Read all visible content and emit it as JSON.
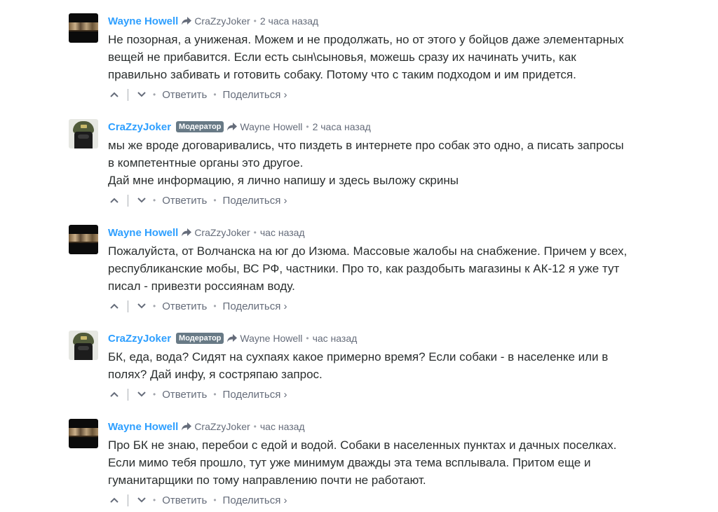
{
  "labels": {
    "reply": "Ответить",
    "share": "Поделиться ›",
    "moderator": "Модератор",
    "dot": "•"
  },
  "comments": [
    {
      "author": "Wayne Howell",
      "reply_to": "CraZzyJoker",
      "time": "2 часа назад",
      "avatar": "dark-banner-avatar",
      "lines": [
        "Не позорная, а униженая. Можем и не продолжать, но от этого у бойцов даже элементарных",
        "вещей не прибавится. Если есть сын\\сыновья, можешь сразу их начинать учить, как",
        "правильно забивать и готовить собаку. Потому что с таким подходом и им придется."
      ]
    },
    {
      "author": "CraZzyJoker",
      "reply_to": "Wayne Howell",
      "time": "2 часа назад",
      "avatar": "helmet-avatar",
      "moderator": true,
      "lines": [
        "мы же вроде договаривались, что пиздеть в интернете про собак это одно, а писать запросы",
        "в компетентные органы это другое.",
        "Дай мне информацию, я лично напишу и здесь выложу скрины"
      ]
    },
    {
      "author": "Wayne Howell",
      "reply_to": "CraZzyJoker",
      "time": "час назад",
      "avatar": "dark-banner-avatar",
      "lines": [
        "Пожалуйста, от Волчанска на юг до Изюма. Массовые жалобы на снабжение. Причем у всех,",
        "республиканские мобы, ВС РФ, частники. Про то, как раздобыть магазины к АК-12 я уже тут",
        "писал - привезти россиянам воду."
      ]
    },
    {
      "author": "CraZzyJoker",
      "reply_to": "Wayne Howell",
      "time": "час назад",
      "avatar": "helmet-avatar",
      "moderator": true,
      "lines": [
        "БК, еда, вода? Сидят на сухпаях какое примерно время? Если собаки - в населенке или в",
        "полях? Дай инфу, я состряпаю запрос."
      ]
    },
    {
      "author": "Wayne Howell",
      "reply_to": "CraZzyJoker",
      "time": "час назад",
      "avatar": "dark-banner-avatar",
      "lines": [
        "Про БК не знаю, перебои с едой и водой. Собаки в населенных пунктах и дачных поселках.",
        "Если мимо тебя прошло, тут уже минимум дважды эта тема всплывала. Притом еще и",
        "гуманитарщики по тому направлению почти не работают."
      ]
    }
  ],
  "colors": {
    "author": "#2e9fff",
    "meta": "#656c7a",
    "text": "#2a2e2e",
    "badge": "#687a86"
  }
}
